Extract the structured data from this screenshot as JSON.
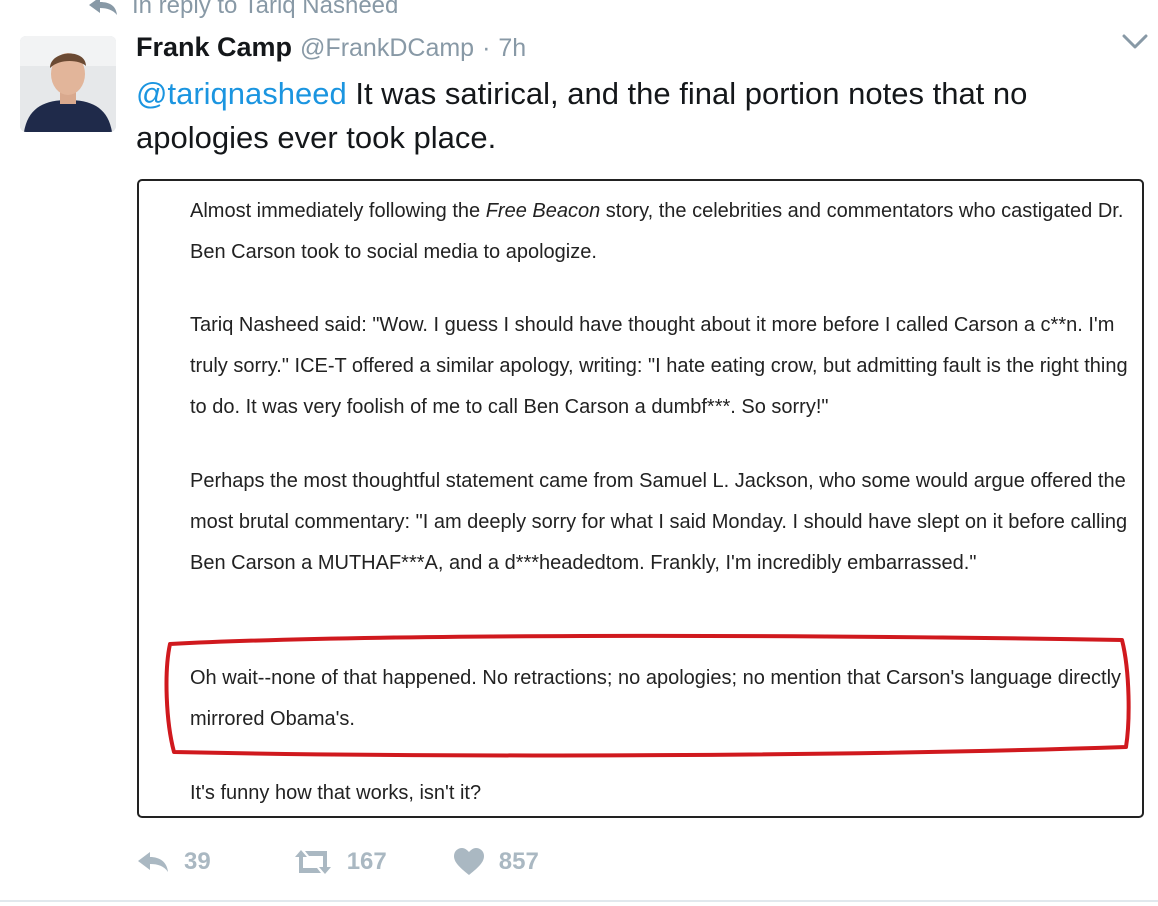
{
  "reply_context": {
    "text": "In reply to Tariq Nasheed"
  },
  "tweet": {
    "author_name": "Frank Camp",
    "author_handle": "@FrankDCamp",
    "separator": "·",
    "timestamp": "7h",
    "mention": "@tariqnasheed",
    "text": " It was satirical, and the final portion notes that no apologies ever took place."
  },
  "article": {
    "p1_a": "Almost immediately following the ",
    "p1_italic": "Free Beacon",
    "p1_b": " story, the celebrities and commentators who castigated Dr. Ben Carson took to social media to apologize.",
    "p2": "Tariq Nasheed said: \"Wow. I guess I should have thought about it more before I called Carson a c**n. I'm truly sorry.\" ICE-T offered a similar apology, writing: \"I hate eating crow, but admitting fault is the right thing to do. It was very foolish of me to call Ben Carson a dumbf***. So sorry!\"",
    "p3": "Perhaps the most thoughtful statement came from Samuel L. Jackson, who some would argue offered the most brutal commentary: \"I am deeply sorry for what I said Monday. I should have slept on it before calling Ben Carson a MUTHAF***A, and a d***headedtom. Frankly, I'm incredibly embarrassed.\"",
    "p4": "Oh wait--none of that happened. No retractions; no apologies; no mention that Carson's language directly mirrored Obama's.",
    "p5": "It's funny how that works, isn't it?",
    "highlight_color": "#d0191e"
  },
  "actions": {
    "reply_count": "39",
    "retweet_count": "167",
    "like_count": "857"
  },
  "colors": {
    "link": "#1b95e0",
    "muted": "#8899a6",
    "action": "#aab8c2"
  },
  "icons": [
    "reply-arrow-icon",
    "chevron-down-icon",
    "reply-icon",
    "retweet-icon",
    "heart-icon"
  ]
}
